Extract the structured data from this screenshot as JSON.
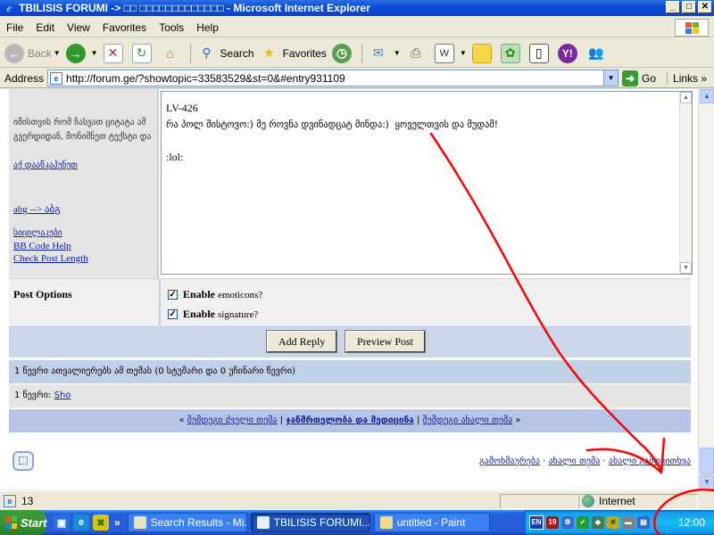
{
  "window": {
    "title": "TBILISIS FORUMI -> □□ □□□□□□□□□□□□□ - Microsoft Internet Explorer",
    "min": "_",
    "max": "□",
    "close": "✕"
  },
  "menu": [
    "File",
    "Edit",
    "View",
    "Favorites",
    "Tools",
    "Help"
  ],
  "toolbar": {
    "back": "Back",
    "search": "Search",
    "favorites": "Favorites"
  },
  "address": {
    "label": "Address",
    "url": "http://forum.ge/?showtopic=33583529&st=0&#entry931109",
    "go": "Go",
    "links": "Links"
  },
  "sidebar": {
    "guide_text": "იმისთვის რომ ჩასვათ ციტატა ამ გვერდიდან, მონიშნეთ ტექსტი და",
    "links": [
      {
        "label": "აქ დააწკაპუნეთ"
      },
      {
        "label": "abg --> აბგ"
      },
      {
        "label": "სიცილაკები"
      },
      {
        "label": "BB Code Help"
      },
      {
        "label": "Check Post Length"
      }
    ]
  },
  "post": {
    "line1": "LV-426",
    "line2": "რა პოლ შისტოვო:) მე როვნა დვინადცატ მინდა:)  ყოველთვის და მუდამ!",
    "line3": "",
    "line4": ":lol:"
  },
  "options": {
    "heading": "Post Options",
    "emoticons_bold": "Enable",
    "emoticons_rest": "emoticons?",
    "signature_bold": "Enable",
    "signature_rest": "signature?",
    "check_mark": "✓"
  },
  "buttons": {
    "add_reply": "Add Reply",
    "preview": "Preview Post"
  },
  "active_users": "1 წევრი ათვალიერებს ამ თემას (0 სტუმარი და 0 უჩინარი წევრი)",
  "members": {
    "prefix": "1 წევრი:",
    "user": "Sho"
  },
  "topic_nav": {
    "open": "«",
    "prev": "შემდეგი ძველი თემა",
    "sep1": "|",
    "middle": "ჯანმრთელობა და მედიცინა",
    "sep2": "|",
    "next": "შემდეგი ახალი თემა",
    "close": "»"
  },
  "bottom_links": [
    {
      "label": "გამოხმაურება"
    },
    {
      "label": "ახალი თემა"
    },
    {
      "label": "ახალი გამოკითხვა"
    }
  ],
  "bottom_sep": "·",
  "status": {
    "text": "13",
    "zone": "Internet"
  },
  "taskbar": {
    "start": "Start",
    "more": "»",
    "tasks": [
      {
        "label": "Search Results - Mi..."
      },
      {
        "label": "TBILISIS FORUMI..."
      },
      {
        "label": "untitled - Paint"
      }
    ],
    "lang": "EN",
    "clock": "12:00"
  },
  "colors": {
    "title_bar": "#0a4fd8",
    "link": "#0b1d98",
    "annotation": "#ff0000",
    "nav_row": "#b6c5e7"
  }
}
